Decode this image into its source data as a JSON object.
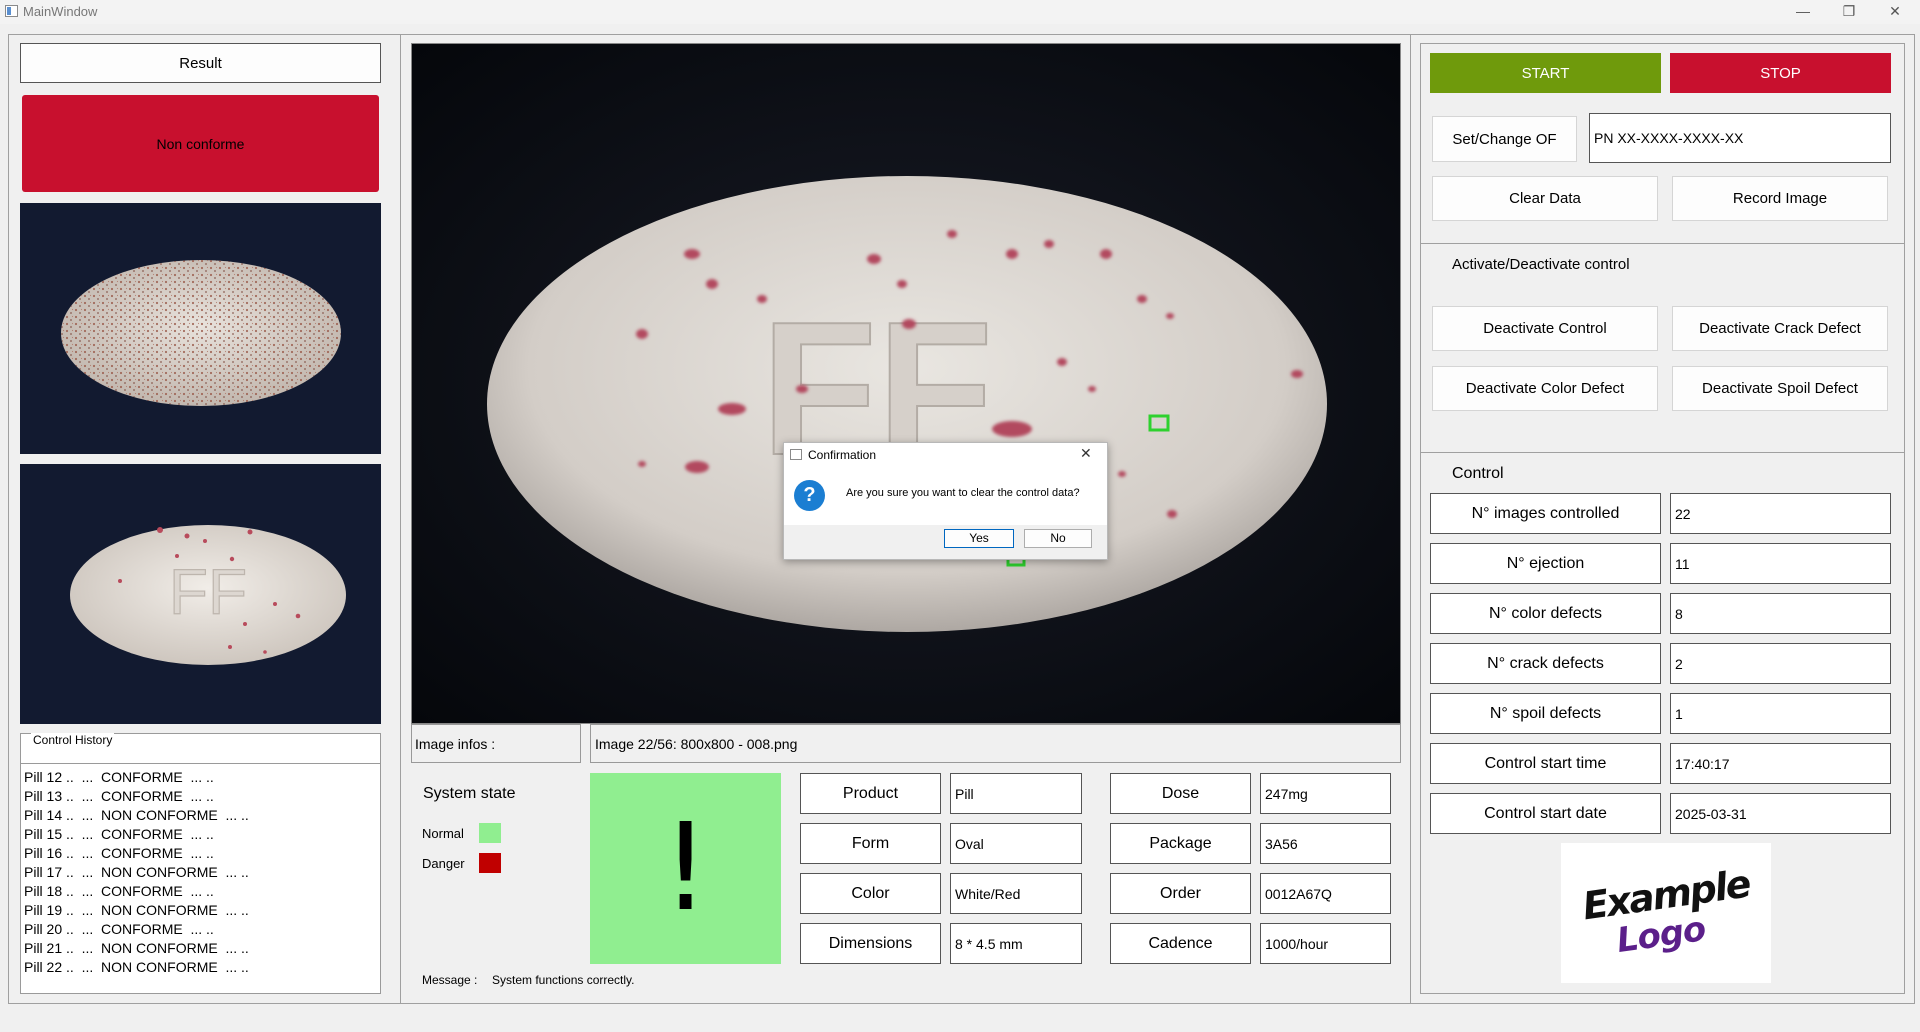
{
  "window": {
    "title": "MainWindow",
    "minimize": "—",
    "restore": "❐",
    "close": "✕"
  },
  "left": {
    "result_button": "Result",
    "status_label": "Non conforme",
    "status_color": "#c8102e",
    "history": {
      "title": "Control History",
      "lines": [
        "Pill 12 ..  ...  CONFORME  ... ..",
        "Pill 13 ..  ...  CONFORME  ... ..",
        "Pill 14 ..  ...  NON CONFORME  ... ..",
        "Pill 15 ..  ...  CONFORME  ... ..",
        "Pill 16 ..  ...  CONFORME  ... ..",
        "Pill 17 ..  ...  NON CONFORME  ... ..",
        "Pill 18 ..  ...  CONFORME  ... ..",
        "Pill 19 ..  ...  NON CONFORME  ... ..",
        "Pill 20 ..  ...  CONFORME  ... ..",
        "Pill 21 ..  ...  NON CONFORME  ... ..",
        "Pill 22 ..  ...  NON CONFORME  ... .."
      ]
    }
  },
  "center": {
    "image_infos_label": "Image infos :",
    "image_infos_value": "Image 22/56: 800x800 - 008.png",
    "pill_marking": "FF",
    "system_state": {
      "title": "System state",
      "normal_label": "Normal",
      "normal_color": "#90ee90",
      "danger_label": "Danger",
      "danger_color": "#c00000",
      "indicator_symbol": "!",
      "indicator_color": "#90ee90",
      "message_label": "Message :",
      "message_text": "System functions correctly."
    },
    "product_info": [
      {
        "label": "Product",
        "value": "Pill"
      },
      {
        "label": "Form",
        "value": "Oval"
      },
      {
        "label": "Color",
        "value": "White/Red"
      },
      {
        "label": "Dimensions",
        "value": "8 * 4.5 mm"
      }
    ],
    "order_info": [
      {
        "label": "Dose",
        "value": "247mg"
      },
      {
        "label": "Package",
        "value": "3A56"
      },
      {
        "label": "Order",
        "value": "0012A67Q"
      },
      {
        "label": "Cadence",
        "value": "1000/hour"
      }
    ]
  },
  "right": {
    "start_label": "START",
    "start_color": "#6f9a0c",
    "stop_label": "STOP",
    "stop_color": "#c8102e",
    "set_of_label": "Set/Change OF",
    "of_value": "PN XX-XXXX-XXXX-XX",
    "clear_data_label": "Clear Data",
    "record_image_label": "Record Image",
    "activate_title": "Activate/Deactivate control",
    "deactivate_control": "Deactivate Control",
    "deactivate_crack": "Deactivate Crack Defect",
    "deactivate_color": "Deactivate Color Defect",
    "deactivate_spoil": "Deactivate Spoil Defect",
    "control_title": "Control",
    "control_rows": [
      {
        "label": "N° images controlled",
        "value": "22"
      },
      {
        "label": "N° ejection",
        "value": "11"
      },
      {
        "label": "N° color defects",
        "value": "8"
      },
      {
        "label": "N° crack defects",
        "value": "2"
      },
      {
        "label": "N° spoil defects",
        "value": "1"
      },
      {
        "label": "Control start time",
        "value": "17:40:17"
      },
      {
        "label": "Control start date",
        "value": "2025-03-31"
      }
    ],
    "logo_line1": "Example",
    "logo_line2": "Logo"
  },
  "dialog": {
    "title": "Confirmation",
    "question": "Are you sure you want to clear the control data?",
    "yes_label": "Yes",
    "no_label": "No",
    "icon_symbol": "?"
  }
}
